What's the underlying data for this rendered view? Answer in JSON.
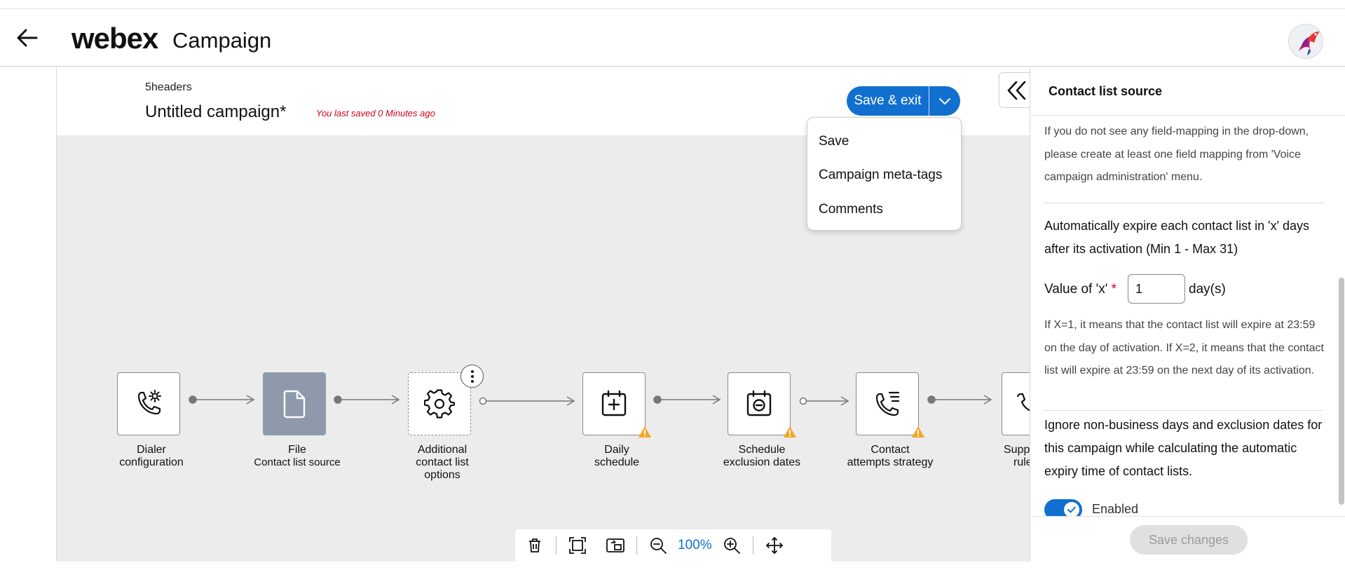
{
  "header": {
    "brand": "webex",
    "app_name": "Campaign"
  },
  "campaign": {
    "project_name": "5headers",
    "title": "Untitled campaign*",
    "saved_note": "You last saved 0 Minutes ago"
  },
  "actions": {
    "save_exit_label": "Save & exit",
    "menu": [
      "Save",
      "Campaign meta-tags",
      "Comments"
    ]
  },
  "nodes": [
    {
      "name": "dialer",
      "icon": "phone-settings-icon",
      "label_1": "Dialer",
      "label_2": "configuration",
      "warning": false
    },
    {
      "name": "file",
      "icon": "file-icon",
      "label_1": "File",
      "label_2": "Contact list source",
      "warning": false
    },
    {
      "name": "additional",
      "icon": "gear-icon",
      "label_1": "Additional",
      "label_2": "contact list",
      "label_3": "options",
      "warning": false
    },
    {
      "name": "daily",
      "icon": "calendar-plus-icon",
      "label_1": "Daily",
      "label_2": "schedule",
      "warning": true
    },
    {
      "name": "exclusion",
      "icon": "calendar-minus-icon",
      "label_1": "Schedule",
      "label_2": "exclusion dates",
      "warning": true
    },
    {
      "name": "attempts",
      "icon": "phone-list-icon",
      "label_1": "Contact",
      "label_2": "attempts strategy",
      "warning": true
    },
    {
      "name": "suppression",
      "icon": "phone-icon",
      "label_1": "Supp",
      "label_2": "rule",
      "warning": false
    }
  ],
  "toolbar": {
    "zoom": "100%",
    "icons": [
      "trash-icon",
      "fit-screen-icon",
      "minimap-icon",
      "zoom-out-icon",
      "zoom-in-icon",
      "pan-icon"
    ]
  },
  "panel": {
    "title": "Contact list source",
    "mapping_note": "If you do not see any field-mapping in the drop-down, please create at least one field mapping from 'Voice campaign administration' menu.",
    "expire_heading": "Automatically expire each contact list in 'x' days after its activation (Min 1 - Max 31)",
    "x_label": "Value of 'x'",
    "x_required": "*",
    "x_value": "1",
    "x_unit": "day(s)",
    "expire_note": "If X=1, it means that the contact list will expire at 23:59 on the day of activation. If X=2, it means that the contact list will expire at 23:59 on the next day of its activation.",
    "ignore_heading": "Ignore non-business days and exclusion dates for this campaign while calculating the automatic expiry time of contact lists.",
    "toggle_label": "Enabled",
    "save_changes": "Save changes"
  },
  "colors": {
    "accent": "#1170cf",
    "warning": "#f5a623",
    "canvas": "#ececec",
    "node_filled": "#8e9aab",
    "saved_note": "#d0021b"
  }
}
